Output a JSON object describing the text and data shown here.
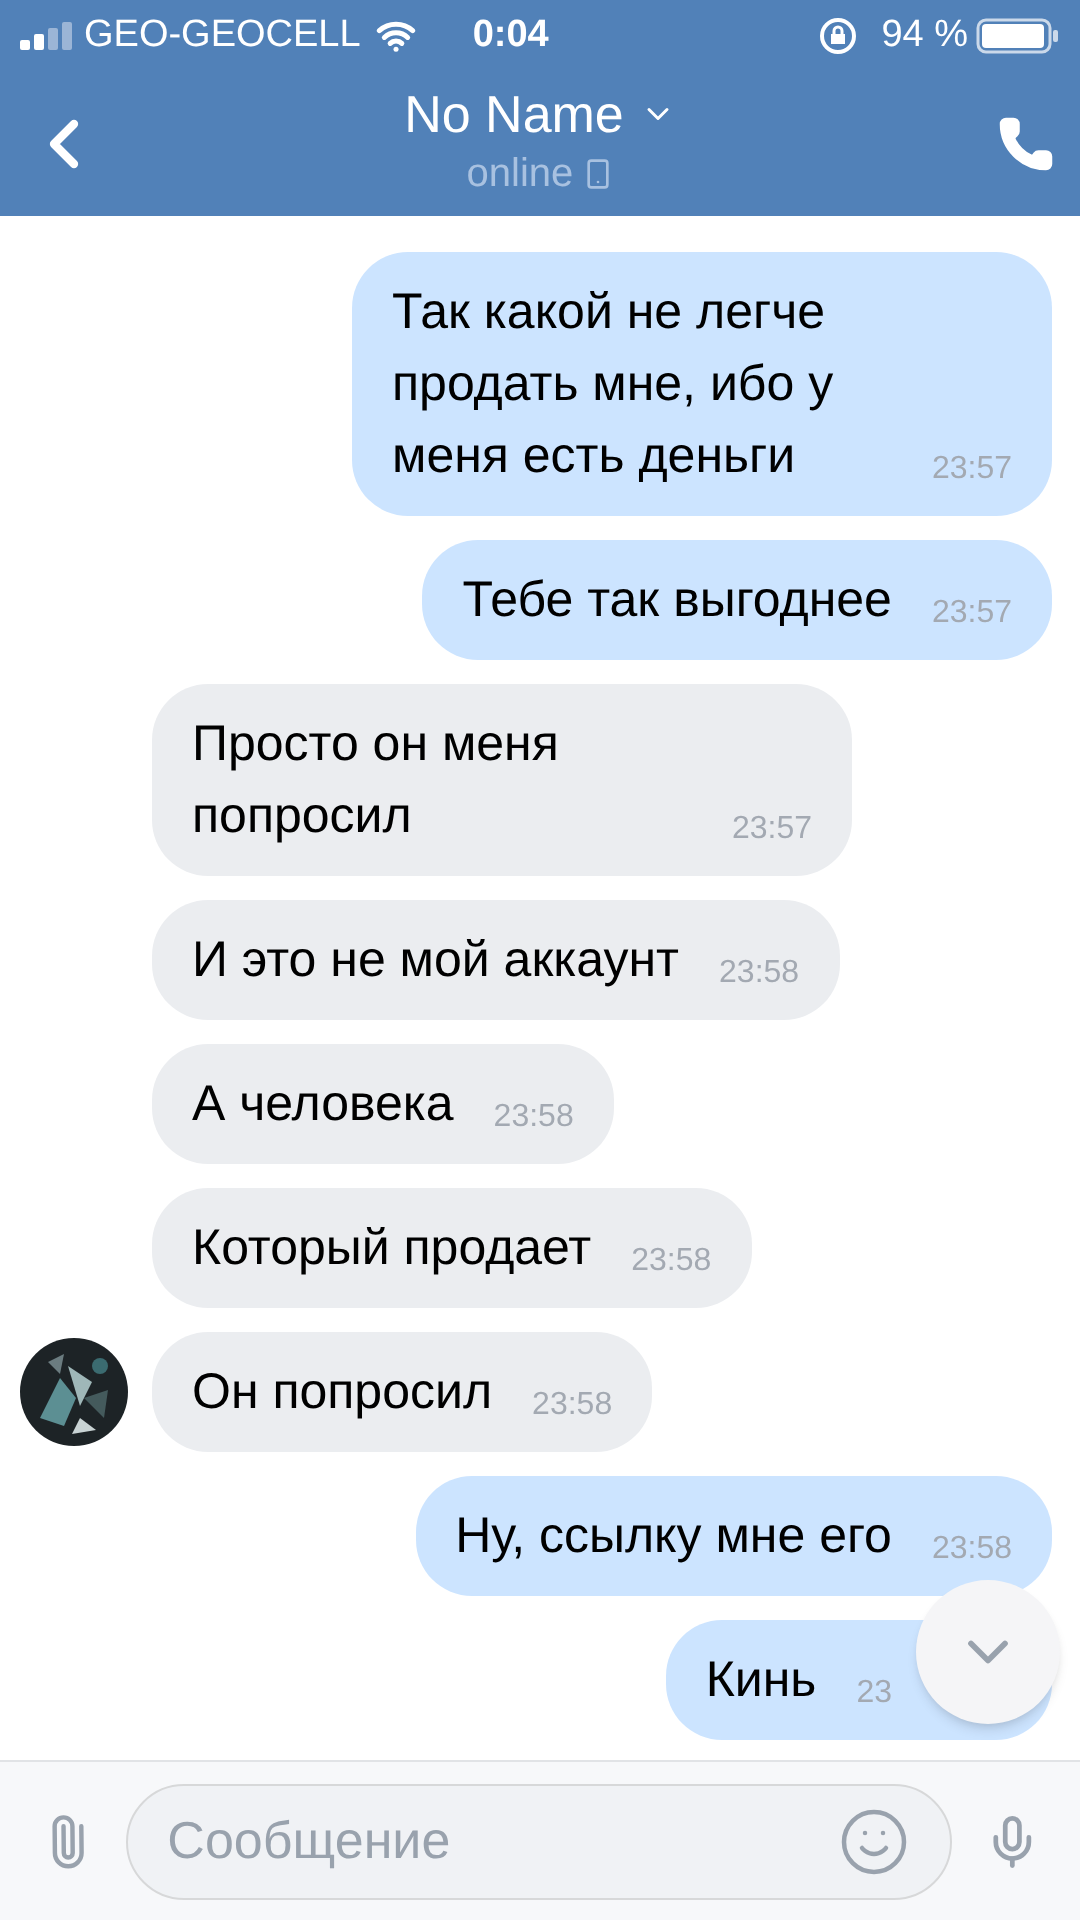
{
  "status_bar": {
    "carrier": "GEO-GEOCELL",
    "time": "0:04",
    "battery": "94 %"
  },
  "header": {
    "title": "No Name",
    "subtitle": "online"
  },
  "messages": [
    {
      "kind": "outgoing",
      "text": "Так какой не легче продать мне, ибо у меня есть деньги",
      "time": "23:57"
    },
    {
      "kind": "outgoing",
      "text": "Тебе так выгоднее",
      "time": "23:57"
    },
    {
      "kind": "incoming",
      "text": "Просто он меня попросил",
      "time": "23:57",
      "avatar": false
    },
    {
      "kind": "incoming",
      "text": "И это не мой аккаунт",
      "time": "23:58",
      "avatar": false
    },
    {
      "kind": "incoming",
      "text": "А человека",
      "time": "23:58",
      "avatar": false
    },
    {
      "kind": "incoming",
      "text": "Который продает",
      "time": "23:58",
      "avatar": false
    },
    {
      "kind": "incoming",
      "text": "Он попросил",
      "time": "23:58",
      "avatar": true
    },
    {
      "kind": "outgoing",
      "text": "Ну, ссылку мне его",
      "time": "23:58"
    },
    {
      "kind": "outgoing",
      "text": "Кинь",
      "time": "23"
    }
  ],
  "composer": {
    "placeholder": "Сообщение"
  }
}
